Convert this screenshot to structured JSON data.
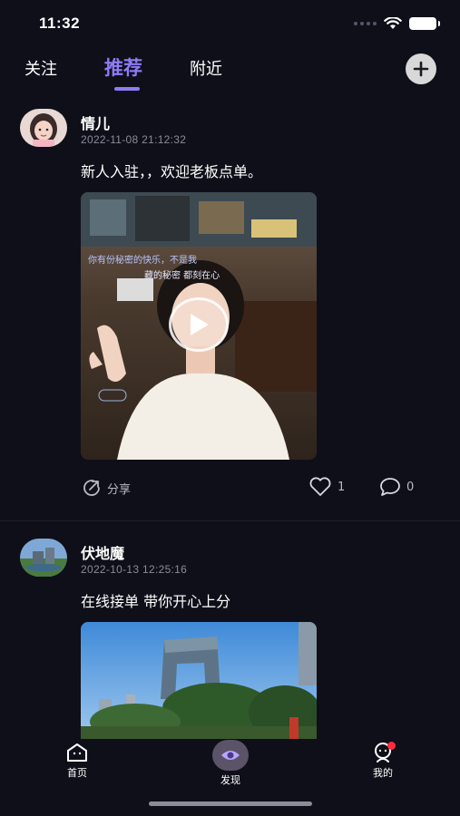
{
  "status_bar": {
    "time": "11:32"
  },
  "top_tabs": {
    "follow": "关注",
    "recommend": "推荐",
    "nearby": "附近",
    "active": "recommend"
  },
  "posts": [
    {
      "username": "情儿",
      "timestamp": "2022-11-08 21:12:32",
      "text": "新人入驻，，欢迎老板点单。",
      "media_type": "video",
      "share_label": "分享",
      "likes": "1",
      "comments": "0"
    },
    {
      "username": "伏地魔",
      "timestamp": "2022-10-13 12:25:16",
      "text": "在线接单 带你开心上分",
      "media_type": "image"
    }
  ],
  "bottom_nav": {
    "home": "首页",
    "discover": "发现",
    "mine": "我的"
  },
  "colors": {
    "accent": "#8e7cf5",
    "background": "#0f0f1a",
    "badge": "#ff2a3d"
  },
  "icons": [
    "wifi-icon",
    "battery-icon",
    "add-icon",
    "play-icon",
    "share-icon",
    "heart-icon",
    "comment-icon",
    "home-icon",
    "discover-eye-icon",
    "profile-icon"
  ]
}
